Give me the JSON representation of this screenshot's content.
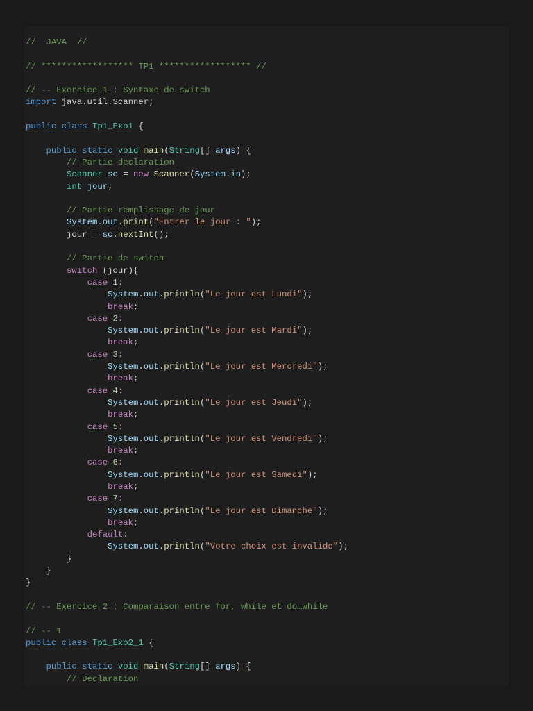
{
  "code_lines": [
    [
      [
        "c",
        "//  JAVA  //"
      ]
    ],
    [],
    [
      [
        "c",
        "// ****************** TP1 ****************** //"
      ]
    ],
    [],
    [
      [
        "c",
        "// -- Exercice 1 : Syntaxe de switch"
      ]
    ],
    [
      [
        "k",
        "import"
      ],
      [
        "d",
        " java.util.Scanner;"
      ]
    ],
    [],
    [
      [
        "k",
        "public class "
      ],
      [
        "t",
        "Tp1_Exo1"
      ],
      [
        "d",
        " {"
      ]
    ],
    [],
    [
      [
        "d",
        "    "
      ],
      [
        "k",
        "public static "
      ],
      [
        "t",
        "void "
      ],
      [
        "f",
        "main"
      ],
      [
        "d",
        "("
      ],
      [
        "t",
        "String"
      ],
      [
        "d",
        "[] "
      ],
      [
        "v",
        "args"
      ],
      [
        "d",
        ") {"
      ]
    ],
    [
      [
        "d",
        "        "
      ],
      [
        "c",
        "// Partie declaration"
      ]
    ],
    [
      [
        "d",
        "        "
      ],
      [
        "t",
        "Scanner "
      ],
      [
        "v",
        "sc"
      ],
      [
        "d",
        " = "
      ],
      [
        "p",
        "new "
      ],
      [
        "f",
        "Scanner"
      ],
      [
        "d",
        "("
      ],
      [
        "v",
        "System"
      ],
      [
        "d",
        "."
      ],
      [
        "v",
        "in"
      ],
      [
        "d",
        ");"
      ]
    ],
    [
      [
        "d",
        "        "
      ],
      [
        "t",
        "int "
      ],
      [
        "v",
        "jour"
      ],
      [
        "d",
        ";"
      ]
    ],
    [],
    [
      [
        "d",
        "        "
      ],
      [
        "c",
        "// Partie remplissage de jour"
      ]
    ],
    [
      [
        "d",
        "        "
      ],
      [
        "v",
        "System"
      ],
      [
        "d",
        "."
      ],
      [
        "v",
        "out"
      ],
      [
        "d",
        "."
      ],
      [
        "f",
        "print"
      ],
      [
        "d",
        "("
      ],
      [
        "s",
        "\"Entrer le jour : \""
      ],
      [
        "d",
        ");"
      ]
    ],
    [
      [
        "d",
        "        jour = "
      ],
      [
        "v",
        "sc"
      ],
      [
        "d",
        "."
      ],
      [
        "f",
        "nextInt"
      ],
      [
        "d",
        "();"
      ]
    ],
    [],
    [
      [
        "d",
        "        "
      ],
      [
        "c",
        "// Partie de switch"
      ]
    ],
    [
      [
        "d",
        "        "
      ],
      [
        "p",
        "switch"
      ],
      [
        "d",
        " (jour){"
      ]
    ],
    [
      [
        "d",
        "            "
      ],
      [
        "p",
        "case "
      ],
      [
        "n",
        "1"
      ],
      [
        "p",
        ":"
      ]
    ],
    [
      [
        "d",
        "                "
      ],
      [
        "v",
        "System"
      ],
      [
        "d",
        "."
      ],
      [
        "v",
        "out"
      ],
      [
        "d",
        "."
      ],
      [
        "f",
        "println"
      ],
      [
        "d",
        "("
      ],
      [
        "s",
        "\"Le jour est Lundi\""
      ],
      [
        "d",
        ");"
      ]
    ],
    [
      [
        "d",
        "                "
      ],
      [
        "p",
        "break"
      ],
      [
        "d",
        ";"
      ]
    ],
    [
      [
        "d",
        "            "
      ],
      [
        "p",
        "case "
      ],
      [
        "n",
        "2"
      ],
      [
        "p",
        ":"
      ]
    ],
    [
      [
        "d",
        "                "
      ],
      [
        "v",
        "System"
      ],
      [
        "d",
        "."
      ],
      [
        "v",
        "out"
      ],
      [
        "d",
        "."
      ],
      [
        "f",
        "println"
      ],
      [
        "d",
        "("
      ],
      [
        "s",
        "\"Le jour est Mardi\""
      ],
      [
        "d",
        ");"
      ]
    ],
    [
      [
        "d",
        "                "
      ],
      [
        "p",
        "break"
      ],
      [
        "d",
        ";"
      ]
    ],
    [
      [
        "d",
        "            "
      ],
      [
        "p",
        "case "
      ],
      [
        "n",
        "3"
      ],
      [
        "p",
        ":"
      ]
    ],
    [
      [
        "d",
        "                "
      ],
      [
        "v",
        "System"
      ],
      [
        "d",
        "."
      ],
      [
        "v",
        "out"
      ],
      [
        "d",
        "."
      ],
      [
        "f",
        "println"
      ],
      [
        "d",
        "("
      ],
      [
        "s",
        "\"Le jour est Mercredi\""
      ],
      [
        "d",
        ");"
      ]
    ],
    [
      [
        "d",
        "                "
      ],
      [
        "p",
        "break"
      ],
      [
        "d",
        ";"
      ]
    ],
    [
      [
        "d",
        "            "
      ],
      [
        "p",
        "case "
      ],
      [
        "n",
        "4"
      ],
      [
        "p",
        ":"
      ]
    ],
    [
      [
        "d",
        "                "
      ],
      [
        "v",
        "System"
      ],
      [
        "d",
        "."
      ],
      [
        "v",
        "out"
      ],
      [
        "d",
        "."
      ],
      [
        "f",
        "println"
      ],
      [
        "d",
        "("
      ],
      [
        "s",
        "\"Le jour est Jeudi\""
      ],
      [
        "d",
        ");"
      ]
    ],
    [
      [
        "d",
        "                "
      ],
      [
        "p",
        "break"
      ],
      [
        "d",
        ";"
      ]
    ],
    [
      [
        "d",
        "            "
      ],
      [
        "p",
        "case "
      ],
      [
        "n",
        "5"
      ],
      [
        "p",
        ":"
      ]
    ],
    [
      [
        "d",
        "                "
      ],
      [
        "v",
        "System"
      ],
      [
        "d",
        "."
      ],
      [
        "v",
        "out"
      ],
      [
        "d",
        "."
      ],
      [
        "f",
        "println"
      ],
      [
        "d",
        "("
      ],
      [
        "s",
        "\"Le jour est Vendredi\""
      ],
      [
        "d",
        ");"
      ]
    ],
    [
      [
        "d",
        "                "
      ],
      [
        "p",
        "break"
      ],
      [
        "d",
        ";"
      ]
    ],
    [
      [
        "d",
        "            "
      ],
      [
        "p",
        "case "
      ],
      [
        "n",
        "6"
      ],
      [
        "p",
        ":"
      ]
    ],
    [
      [
        "d",
        "                "
      ],
      [
        "v",
        "System"
      ],
      [
        "d",
        "."
      ],
      [
        "v",
        "out"
      ],
      [
        "d",
        "."
      ],
      [
        "f",
        "println"
      ],
      [
        "d",
        "("
      ],
      [
        "s",
        "\"Le jour est Samedi\""
      ],
      [
        "d",
        ");"
      ]
    ],
    [
      [
        "d",
        "                "
      ],
      [
        "p",
        "break"
      ],
      [
        "d",
        ";"
      ]
    ],
    [
      [
        "d",
        "            "
      ],
      [
        "p",
        "case "
      ],
      [
        "n",
        "7"
      ],
      [
        "p",
        ":"
      ]
    ],
    [
      [
        "d",
        "                "
      ],
      [
        "v",
        "System"
      ],
      [
        "d",
        "."
      ],
      [
        "v",
        "out"
      ],
      [
        "d",
        "."
      ],
      [
        "f",
        "println"
      ],
      [
        "d",
        "("
      ],
      [
        "s",
        "\"Le jour est Dimanche\""
      ],
      [
        "d",
        ");"
      ]
    ],
    [
      [
        "d",
        "                "
      ],
      [
        "p",
        "break"
      ],
      [
        "d",
        ";"
      ]
    ],
    [
      [
        "d",
        "            "
      ],
      [
        "p",
        "default"
      ],
      [
        "d",
        ":"
      ]
    ],
    [
      [
        "d",
        "                "
      ],
      [
        "v",
        "System"
      ],
      [
        "d",
        "."
      ],
      [
        "v",
        "out"
      ],
      [
        "d",
        "."
      ],
      [
        "f",
        "println"
      ],
      [
        "d",
        "("
      ],
      [
        "s",
        "\"Votre choix est invalide\""
      ],
      [
        "d",
        ");"
      ]
    ],
    [
      [
        "d",
        "        }"
      ]
    ],
    [
      [
        "d",
        "    }"
      ]
    ],
    [
      [
        "d",
        "}"
      ]
    ],
    [],
    [
      [
        "c",
        "// -- Exercice 2 : Comparaison entre for, while et do…while"
      ]
    ],
    [],
    [
      [
        "c",
        "// -- 1"
      ]
    ],
    [
      [
        "k",
        "public class "
      ],
      [
        "t",
        "Tp1_Exo2_1"
      ],
      [
        "d",
        " {"
      ]
    ],
    [],
    [
      [
        "d",
        "    "
      ],
      [
        "k",
        "public static "
      ],
      [
        "t",
        "void "
      ],
      [
        "f",
        "main"
      ],
      [
        "d",
        "("
      ],
      [
        "t",
        "String"
      ],
      [
        "d",
        "[] "
      ],
      [
        "v",
        "args"
      ],
      [
        "d",
        ") {"
      ]
    ],
    [
      [
        "d",
        "        "
      ],
      [
        "c",
        "// Declaration"
      ]
    ]
  ]
}
